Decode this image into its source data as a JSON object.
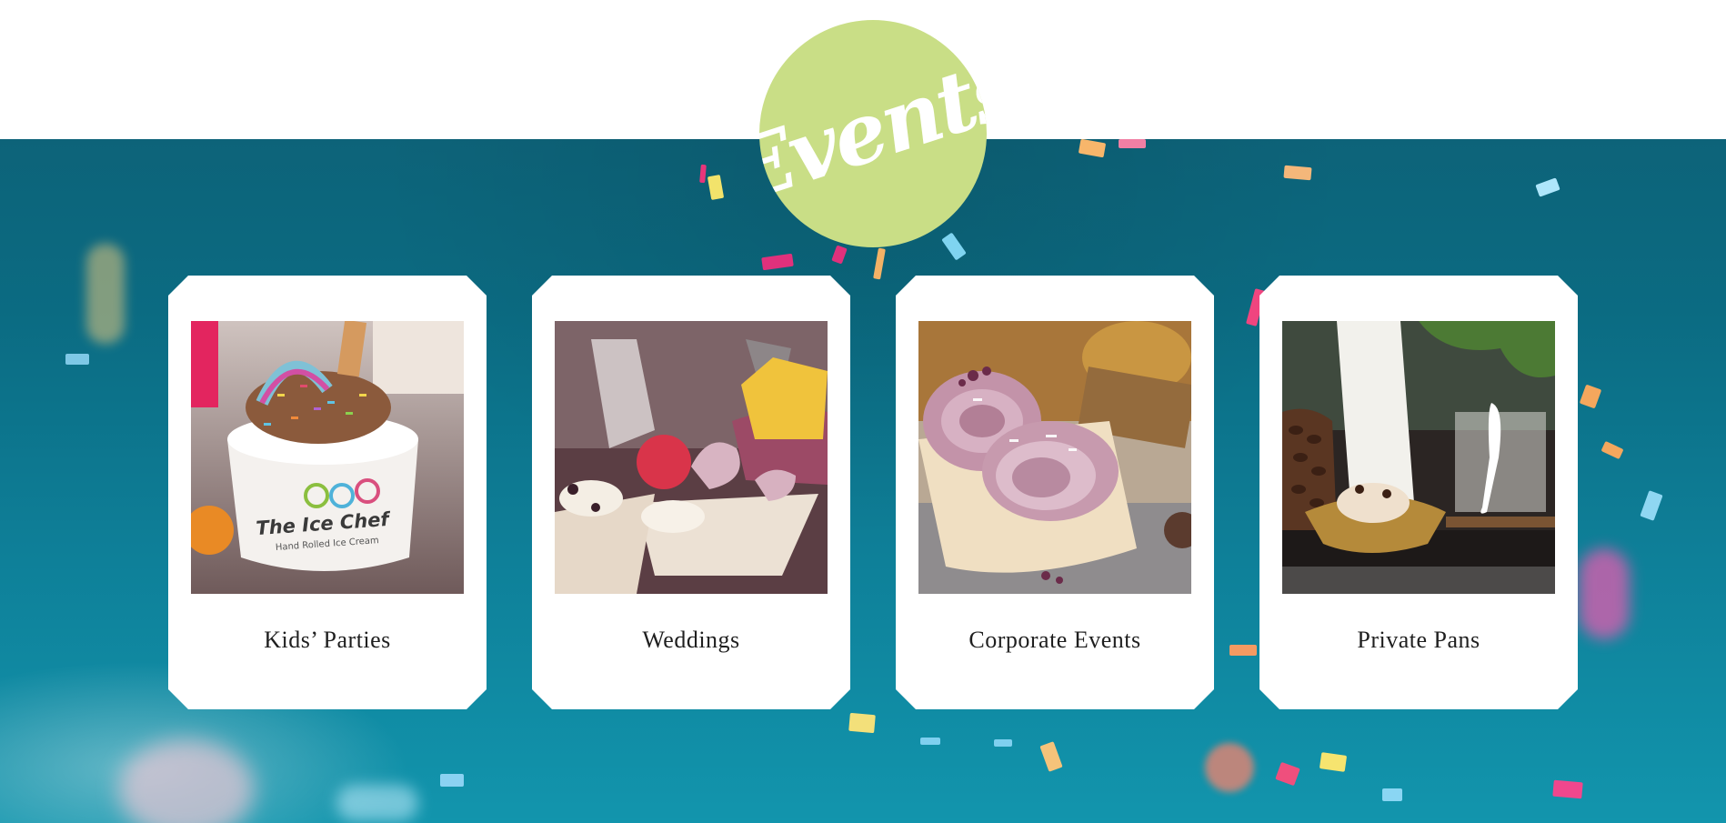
{
  "badge": {
    "text": "Events"
  },
  "cards": [
    {
      "title": "Kids’ Parties",
      "image": "ice-cream-cup-photo",
      "cup_text": "The Ice Chef",
      "cup_subtext": "Hand Rolled Ice Cream"
    },
    {
      "title": "Weddings",
      "image": "wedding-rolled-ice-cream-photo"
    },
    {
      "title": "Corporate Events",
      "image": "corporate-rolled-ice-cream-photo"
    },
    {
      "title": "Private Pans",
      "image": "private-pan-coffee-ice-cream-photo"
    }
  ],
  "colors": {
    "badge": "#c9de86",
    "hero_background": "#0e7f98",
    "card_background": "#ffffff",
    "title_text": "#1f1f1f"
  }
}
